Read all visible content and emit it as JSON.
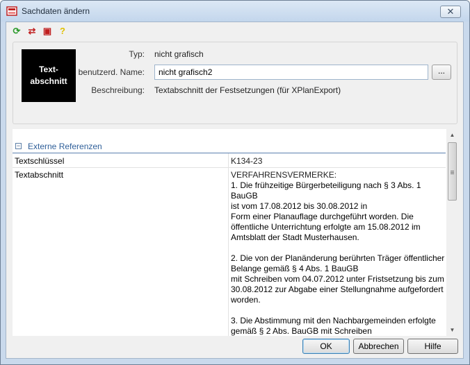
{
  "window": {
    "title": "Sachdaten ändern",
    "close_glyph": "✕"
  },
  "toolbar": [
    {
      "name": "refresh-icon",
      "glyph": "⟳",
      "color": "#2c9a2c"
    },
    {
      "name": "swap-icon",
      "glyph": "⇄",
      "color": "#c02020"
    },
    {
      "name": "data-icon",
      "glyph": "▣",
      "color": "#c02020"
    },
    {
      "name": "help-icon",
      "glyph": "?",
      "color": "#e0c000"
    }
  ],
  "header": {
    "image_text": "Text-\nabschnitt",
    "typ_label": "Typ:",
    "typ_value": "nicht grafisch",
    "name_label": "benutzerd. Name:",
    "name_value": "nicht grafisch2",
    "browse_label": "...",
    "desc_label": "Beschreibung:",
    "desc_value": "Textabschnitt der Festsetzungen (für XPlanExport)"
  },
  "section": {
    "label": "Externe Referenzen",
    "toggle": "−"
  },
  "rows": [
    {
      "key": "Textschlüssel",
      "value": "K134-23"
    },
    {
      "key": "Textabschnitt",
      "value": "VERFAHRENSVERMERKE:"
    }
  ],
  "text_block": "\n1. Die frühzeitige Bürgerbeteiligung nach § 3 Abs. 1 BauGB\nist vom 17.08.2012 bis 30.08.2012 in\nForm einer Planauflage durchgeführt worden. Die\nöffentliche Unterrichtung erfolgte am 15.08.2012 im\nAmtsblatt der Stadt Musterhausen.\n\n2. Die von der Planänderung berührten Träger öffentlicher\nBelange gemäß § 4 Abs. 1 BauGB\nmit Schreiben vom 04.07.2012 unter Fristsetzung bis zum\n30.08.2012 zur Abgabe einer Stellungnahme aufgefordert\nworden.\n\n3. Die Abstimmung mit den Nachbargemeinden erfolgte\ngemäß § 2 Abs. BauGB mit Schreiben",
  "scrollbar": {
    "up": "▲",
    "down": "▼"
  },
  "buttons": {
    "ok": "OK",
    "cancel": "Abbrechen",
    "help": "Hilfe"
  }
}
